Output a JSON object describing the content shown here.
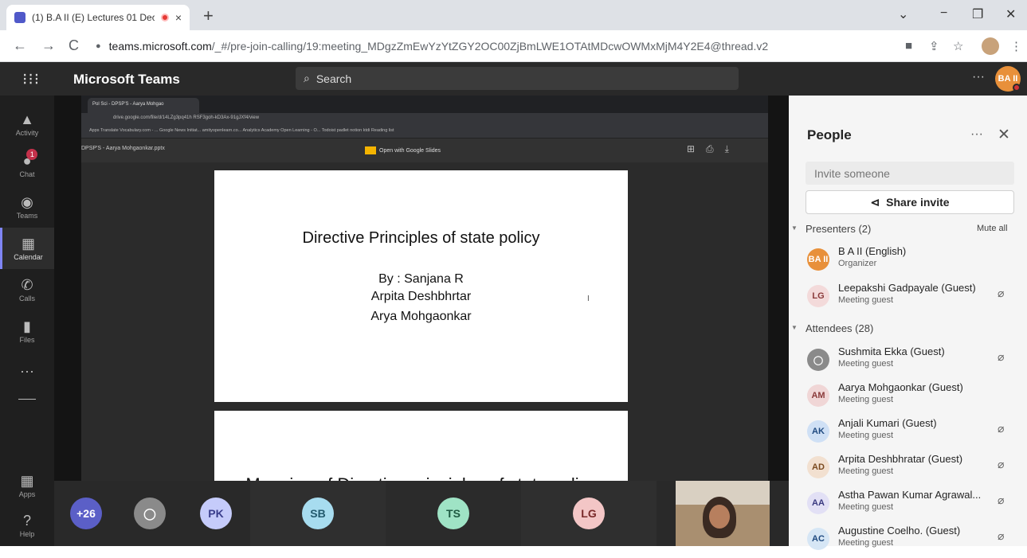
{
  "browser": {
    "tab_title": "(1) B.A II (E) Lectures 01 Dec",
    "tab_close": "×",
    "new_tab": "+",
    "url_host": "teams.microsoft.com",
    "url_path": "/_#/pre-join-calling/19:meeting_MDgzZmEwYzYtZGY2OC00ZjBmLWE1OTAtMDcwOWMxMjM4Y2E4@thread.v2",
    "back_icon": "←",
    "forward_icon": "→",
    "reload_icon": "C",
    "lock_icon": "🔒",
    "minimize": "−",
    "restore": "❐",
    "close": "✕",
    "tab_search": "⌄"
  },
  "teams": {
    "app_name": "Microsoft Teams",
    "search_placeholder": "Search",
    "more": "···",
    "user_initials": "BA II"
  },
  "rail": [
    {
      "label": "Activity",
      "icon": "bell-icon"
    },
    {
      "label": "Chat",
      "icon": "chat-icon",
      "badge": "1"
    },
    {
      "label": "Teams",
      "icon": "teams-icon"
    },
    {
      "label": "Calendar",
      "icon": "calendar-icon"
    },
    {
      "label": "Calls",
      "icon": "phone-icon"
    },
    {
      "label": "Files",
      "icon": "file-icon"
    },
    {
      "label": "Apps",
      "icon": "apps-icon"
    },
    {
      "label": "Help",
      "icon": "help-icon"
    }
  ],
  "rail_more": "···",
  "shared": {
    "inner_tab": "Pol Sci - DPSP'S - Aarya Mohgao",
    "inner_url": "drive.google.com/file/d/14LZg3pq41h RSF3goh-kD3Ax-91gJXf4/view",
    "inner_bookmarks": "Apps   Translate   Vocabulary.com - ...   Google News Initiat...   amityopenlearn.co...   Analytics Academy   Open Learning - O...   Todoist   padlet   notion   ktdi       Reading list",
    "file_name": "DPSP'S - Aarya Mohgaonkar.pptx",
    "open_with": "Open with Google Slides"
  },
  "slide1": {
    "title": "Directive Principles of state policy",
    "by": "By : Sanjana R",
    "author2": "Arpita Deshbhrtar",
    "author3": "Arya Mohgaonkar"
  },
  "slide2": {
    "title": "Meaning of Directive principles of state policy"
  },
  "strip": [
    {
      "initials": "+26",
      "color": "#5b5fc7",
      "text_color": "#ffffff"
    },
    {
      "initials": "",
      "color": "#8a8a8a",
      "text_color": "#ffffff"
    },
    {
      "initials": "PK",
      "color": "#c5cbfa",
      "text_color": "#3a3e8c"
    },
    {
      "initials": "SB",
      "color": "#a7dcef",
      "text_color": "#235a6e"
    },
    {
      "initials": "TS",
      "color": "#9fe3c5",
      "text_color": "#1e5a42"
    },
    {
      "initials": "LG",
      "color": "#f3c6c6",
      "text_color": "#7a2a2a"
    }
  ],
  "people": {
    "title": "People",
    "more": "···",
    "close": "✕",
    "invite_placeholder": "Invite someone",
    "share_invite": "Share invite",
    "presenters_label": "Presenters (2)",
    "mute_all": "Mute all",
    "attendees_label": "Attendees (28)",
    "presenters": [
      {
        "initials": "BA II",
        "name": "B A II (English)",
        "role": "Organizer",
        "bg": "#e8903a",
        "fg": "#ffffff",
        "mic": ""
      },
      {
        "initials": "LG",
        "name": "Leepakshi Gadpayale (Guest)",
        "role": "Meeting guest",
        "bg": "#f3dada",
        "fg": "#8a3a3a",
        "mic": "🎙"
      }
    ],
    "attendees": [
      {
        "initials": "",
        "name": "Sushmita Ekka (Guest)",
        "role": "Meeting guest",
        "bg": "#8a8a8a",
        "fg": "#ffffff",
        "mic": "🎙"
      },
      {
        "initials": "AM",
        "name": "Aarya Mohgaonkar (Guest)",
        "role": "Meeting guest",
        "bg": "#f0d6d6",
        "fg": "#8a3a3a",
        "mic": ""
      },
      {
        "initials": "AK",
        "name": "Anjali Kumari (Guest)",
        "role": "Meeting guest",
        "bg": "#cfe0f5",
        "fg": "#1f4a80",
        "mic": "🎙"
      },
      {
        "initials": "AD",
        "name": "Arpita Deshbhratar (Guest)",
        "role": "Meeting guest",
        "bg": "#f2e0d0",
        "fg": "#7a4a20",
        "mic": "🎙"
      },
      {
        "initials": "AA",
        "name": "Astha Pawan Kumar Agrawal...",
        "role": "Meeting guest",
        "bg": "#e2e0f5",
        "fg": "#3a3a80",
        "mic": "🎙"
      },
      {
        "initials": "AC",
        "name": "Augustine Coelho. (Guest)",
        "role": "Meeting guest",
        "bg": "#d6e6f5",
        "fg": "#1f4a80",
        "mic": "🎙"
      }
    ]
  }
}
